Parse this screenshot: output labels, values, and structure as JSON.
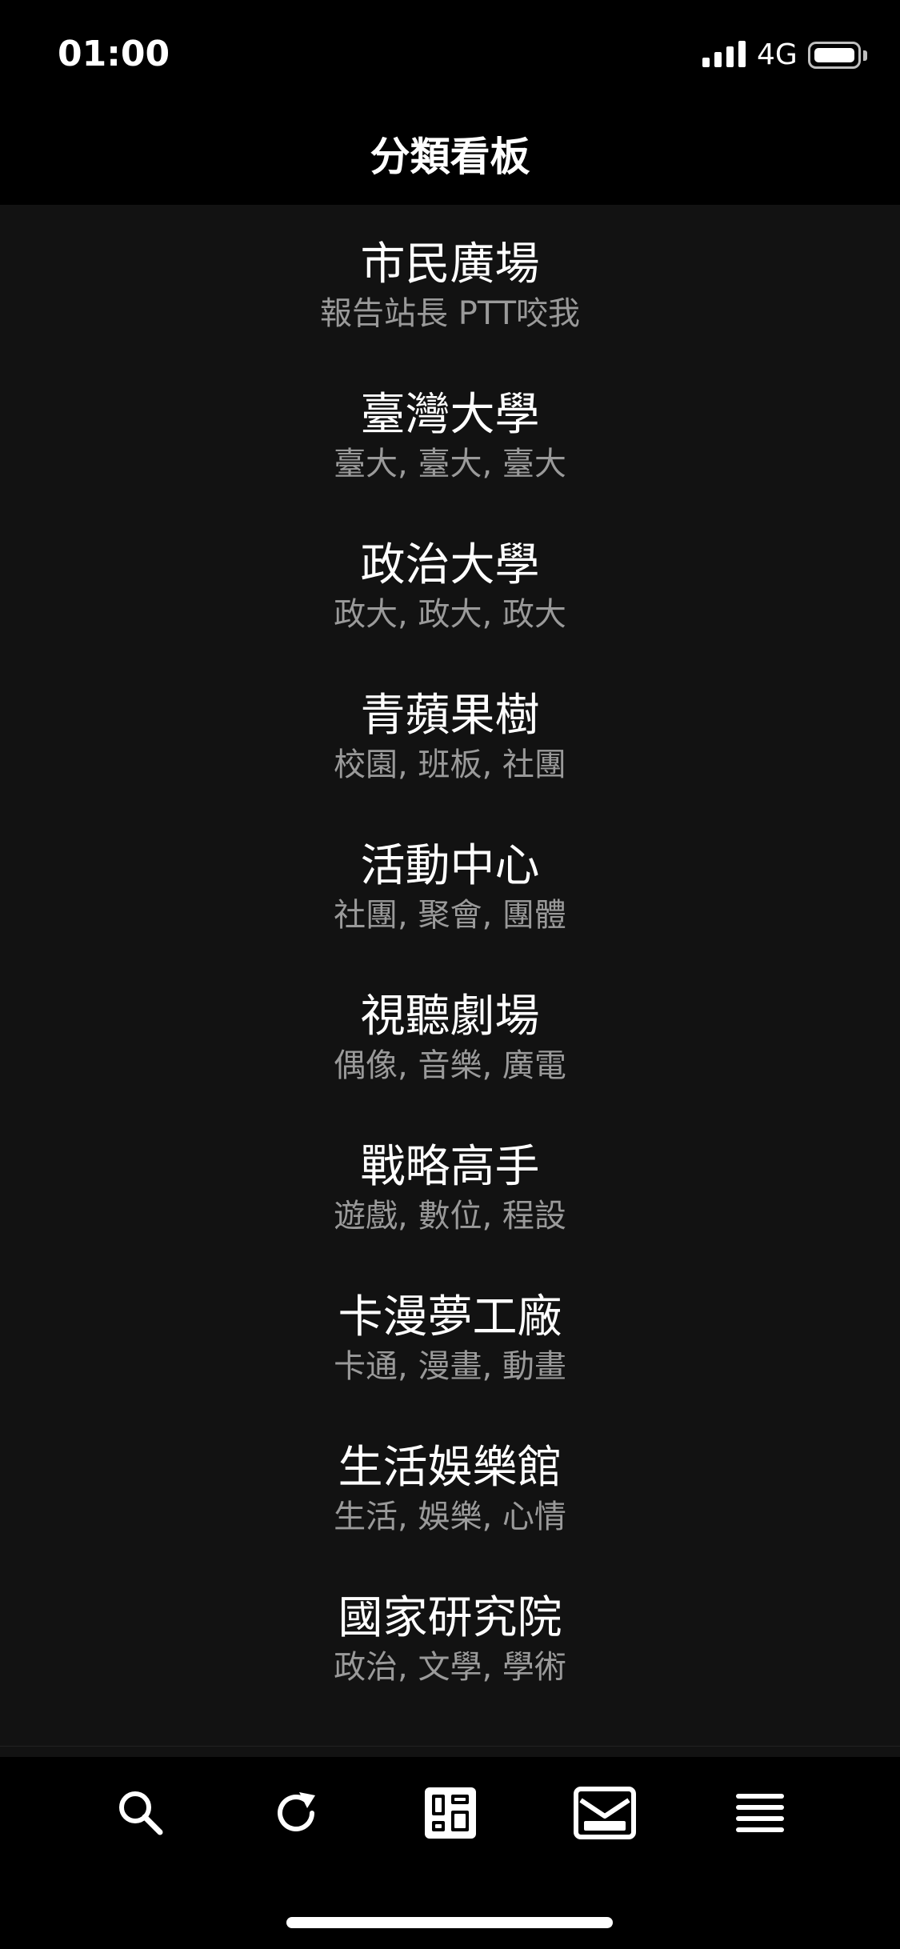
{
  "status_bar": {
    "time": "01:00",
    "network": "4G",
    "battery_level": 1.0,
    "signal_bars": 4
  },
  "header": {
    "title": "分類看板"
  },
  "boards": [
    {
      "name": "市民廣場",
      "description": "報告站長 PTT咬我"
    },
    {
      "name": "臺灣大學",
      "description": "臺大, 臺大, 臺大"
    },
    {
      "name": "政治大學",
      "description": "政大, 政大, 政大"
    },
    {
      "name": "青蘋果樹",
      "description": "校園, 班板, 社團"
    },
    {
      "name": "活動中心",
      "description": "社團, 聚會, 團體"
    },
    {
      "name": "視聽劇場",
      "description": "偶像, 音樂, 廣電"
    },
    {
      "name": "戰略高手",
      "description": "遊戲, 數位, 程設"
    },
    {
      "name": "卡漫夢工廠",
      "description": "卡通, 漫畫, 動畫"
    },
    {
      "name": "生活娛樂館",
      "description": "生活, 娛樂, 心情"
    },
    {
      "name": "國家研究院",
      "description": "政治, 文學, 學術"
    }
  ],
  "tab_bar": {
    "tabs": [
      {
        "icon": "search-icon"
      },
      {
        "icon": "refresh-icon"
      },
      {
        "icon": "boards-grid-icon"
      },
      {
        "icon": "mail-icon"
      },
      {
        "icon": "menu-icon"
      }
    ],
    "active_color": "#ffffff"
  }
}
